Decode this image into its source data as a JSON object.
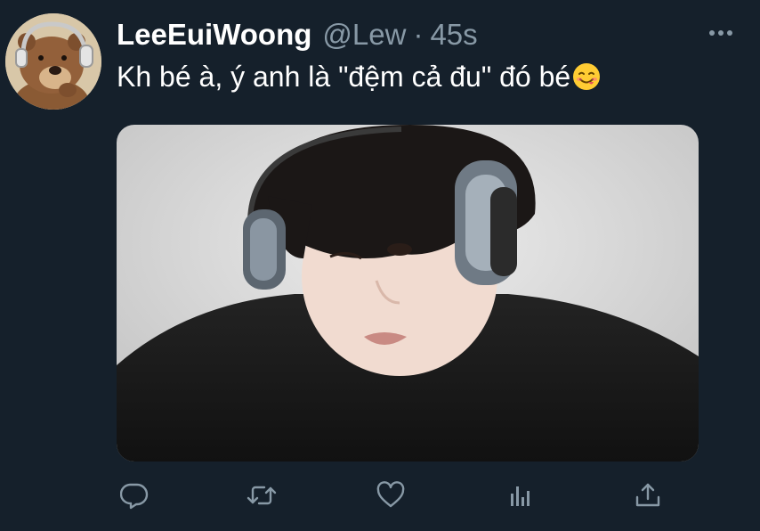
{
  "tweet": {
    "display_name": "LeeEuiWoong",
    "handle": "@Lew",
    "separator": "·",
    "time": "45s",
    "text": "Kh bé à, ý anh là \"đệm cả đu\" đó bé"
  },
  "icons": {
    "more": "more-horizontal-icon",
    "emoji": "face-savoring-food-emoji",
    "reply": "reply-icon",
    "retweet": "retweet-icon",
    "like": "heart-icon",
    "analytics": "analytics-icon",
    "share": "share-icon"
  },
  "colors": {
    "background": "#15202b",
    "primary_text": "#ffffff",
    "secondary_text": "#8899a6"
  }
}
